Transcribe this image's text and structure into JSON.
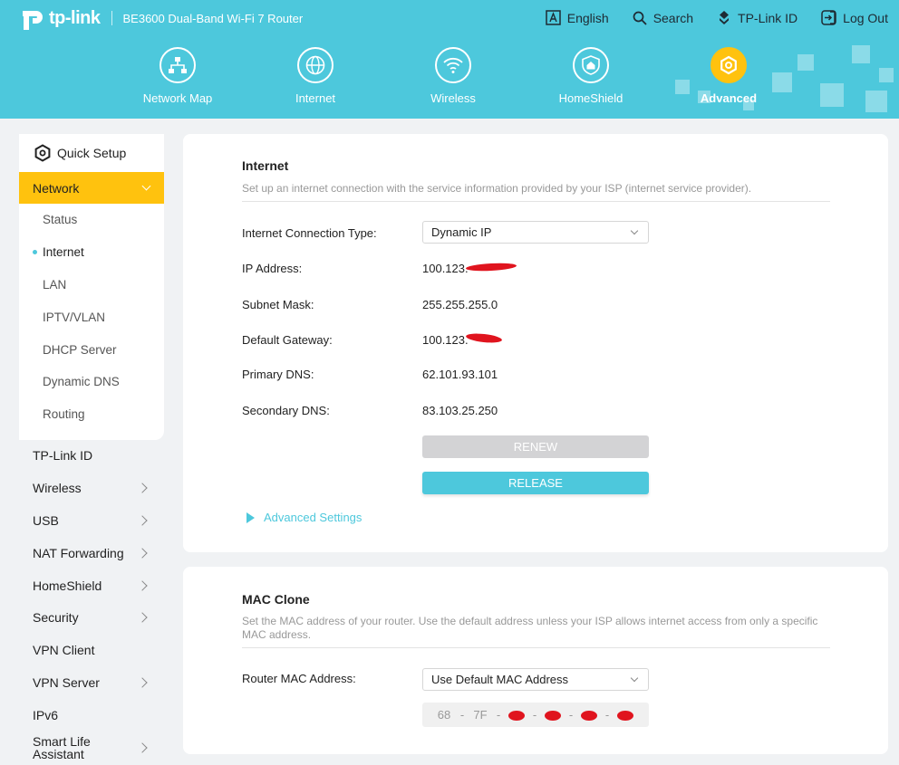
{
  "header": {
    "brand": "tp-link",
    "model": "BE3600 Dual-Band Wi-Fi 7 Router",
    "links": [
      {
        "label": "English",
        "icon": "language-icon"
      },
      {
        "label": "Search",
        "icon": "search-icon"
      },
      {
        "label": "TP-Link ID",
        "icon": "tplink-id-icon"
      },
      {
        "label": "Log Out",
        "icon": "logout-icon"
      }
    ],
    "nav": [
      {
        "label": "Network Map",
        "icon": "network-map-icon"
      },
      {
        "label": "Internet",
        "icon": "globe-icon"
      },
      {
        "label": "Wireless",
        "icon": "wifi-icon"
      },
      {
        "label": "HomeShield",
        "icon": "homeshield-icon"
      },
      {
        "label": "Advanced",
        "icon": "gear-icon",
        "active": true
      }
    ],
    "colors": {
      "header_bg": "#4dc8dc",
      "accent": "#ffc20e"
    }
  },
  "sidebar": {
    "quick_setup": "Quick Setup",
    "network": "Network",
    "network_sub": [
      "Status",
      "Internet",
      "LAN",
      "IPTV/VLAN",
      "DHCP Server",
      "Dynamic DNS",
      "Routing"
    ],
    "active_sub": "Internet",
    "items": [
      {
        "label": "TP-Link ID",
        "has_children": false
      },
      {
        "label": "Wireless",
        "has_children": true
      },
      {
        "label": "USB",
        "has_children": true
      },
      {
        "label": "NAT Forwarding",
        "has_children": true
      },
      {
        "label": "HomeShield",
        "has_children": true
      },
      {
        "label": "Security",
        "has_children": true
      },
      {
        "label": "VPN Client",
        "has_children": false
      },
      {
        "label": "VPN Server",
        "has_children": true
      },
      {
        "label": "IPv6",
        "has_children": false
      },
      {
        "label": "Smart Life Assistant",
        "has_children": true
      }
    ]
  },
  "internet": {
    "title": "Internet",
    "description": "Set up an internet connection with the service information provided by your ISP (internet service provider).",
    "connection_type_label": "Internet Connection Type:",
    "connection_type_value": "Dynamic IP",
    "ip_label": "IP Address:",
    "ip_value": "100.123.",
    "subnet_label": "Subnet Mask:",
    "subnet_value": "255.255.255.0",
    "gateway_label": "Default Gateway:",
    "gateway_value": "100.123.",
    "dns1_label": "Primary DNS:",
    "dns1_value": "62.101.93.101",
    "dns2_label": "Secondary DNS:",
    "dns2_value": "83.103.25.250",
    "renew_label": "RENEW",
    "release_label": "RELEASE",
    "advanced_label": "Advanced Settings"
  },
  "mac_clone": {
    "title": "MAC Clone",
    "description": "Set the MAC address of your router. Use the default address unless your ISP allows internet access from only a specific MAC address.",
    "router_mac_label": "Router MAC Address:",
    "router_mac_value": "Use Default MAC Address",
    "mac_visible": [
      "68",
      "7F"
    ]
  }
}
